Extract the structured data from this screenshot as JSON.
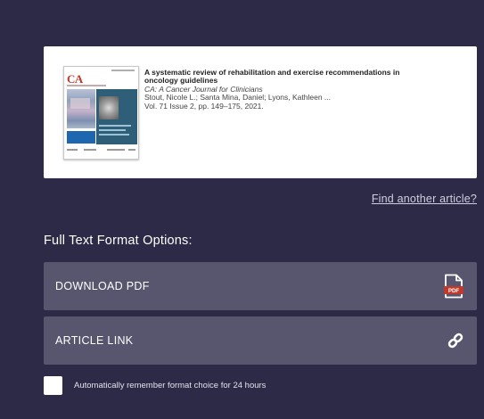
{
  "article": {
    "cover_logo": "CA",
    "title": "A systematic review of rehabilitation and exercise recommendations in oncology guidelines",
    "journal": "CA: A Cancer Journal for Clinicians",
    "authors": "Stout, Nicole L.; Santa Mina, Daniel; Lyons, Kathleen ...",
    "citation": "Vol. 71 Issue 2, pp. 149–175, 2021."
  },
  "find_link": "Find another article?",
  "options_heading": "Full Text Format Options:",
  "options": {
    "download_pdf": "DOWNLOAD PDF",
    "article_link": "ARTICLE LINK"
  },
  "icons": {
    "pdf": "pdf-file-icon",
    "link": "chain-link-icon"
  },
  "remember": {
    "label": "Automatically remember format choice for 24 hours",
    "checked": false
  },
  "colors": {
    "background": "#2c2a47",
    "button": "#58566f",
    "pdf_red": "#c0392b"
  }
}
